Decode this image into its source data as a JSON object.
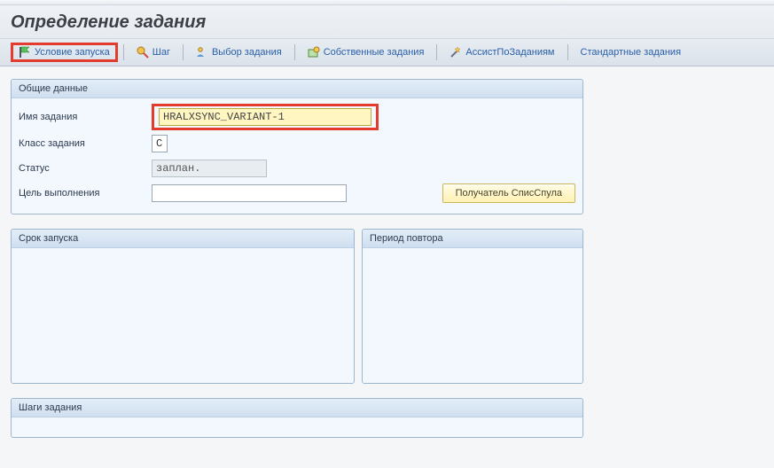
{
  "title": "Определение задания",
  "toolbar": {
    "start_condition": "Условие запуска",
    "step": "Шаг",
    "job_select": "Выбор задания",
    "own_jobs": "Собственные задания",
    "job_wizard": "АссистПоЗаданиям",
    "std_jobs": "Стандартные задания"
  },
  "group_general": {
    "title": "Общие данные",
    "jobname_label": "Имя задания",
    "jobname_value": "HRALXSYNC_VARIANT-1",
    "jobclass_label": "Класс задания",
    "jobclass_value": "C",
    "status_label": "Статус",
    "status_value": "заплан.",
    "exectgt_label": "Цель выполнения",
    "exectgt_value": "",
    "spool_button": "Получатель СписСпула"
  },
  "group_start": {
    "title": "Срок запуска"
  },
  "group_period": {
    "title": "Период повтора"
  },
  "group_steps": {
    "title": "Шаги задания"
  }
}
